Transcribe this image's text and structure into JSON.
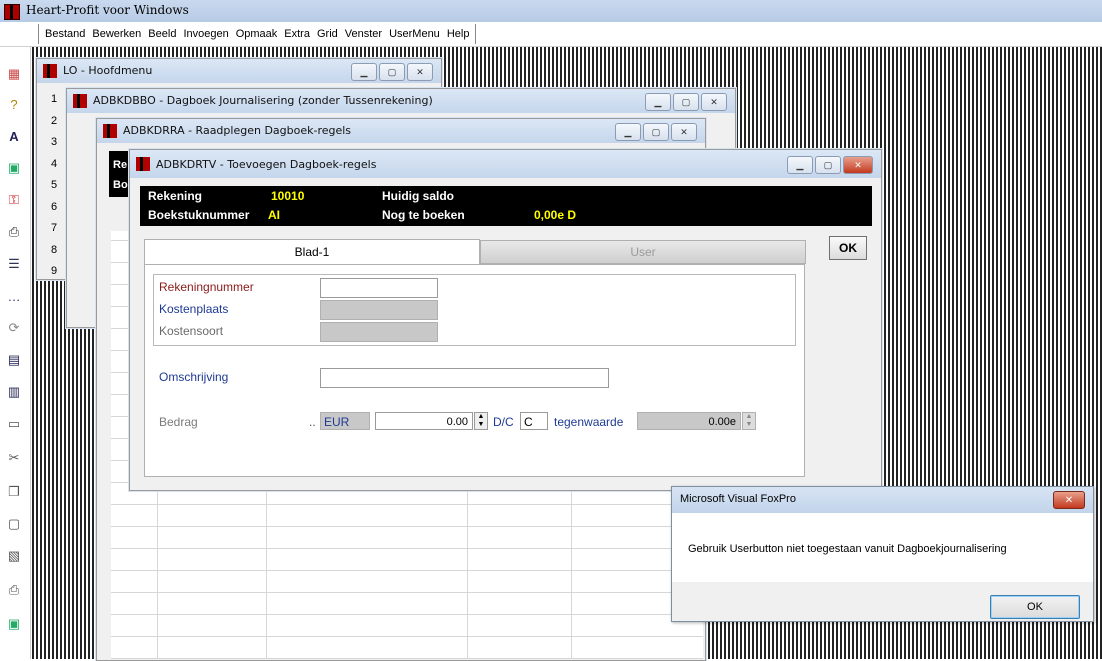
{
  "app": {
    "title": "Heart-Profit voor Windows"
  },
  "menu": [
    "Bestand",
    "Bewerken",
    "Beeld",
    "Invoegen",
    "Opmaak",
    "Extra",
    "Grid",
    "Venster",
    "UserMenu",
    "Help"
  ],
  "toolbar_icons": [
    "form-icon",
    "help-icon",
    "spell-icon",
    "calc-icon",
    "key-icon",
    "print-icon",
    "list-icon",
    "dots-icon",
    "refresh-icon",
    "edit-icon",
    "chart-icon",
    "window-icon",
    "cut-icon",
    "copy-icon",
    "paste-icon",
    "document-icon",
    "printer-icon",
    "screen-icon"
  ],
  "windows": {
    "w1": {
      "title": "LO - Hoofdmenu",
      "numbers": [
        "1",
        "2",
        "3",
        "4",
        "5",
        "6",
        "7",
        "8",
        "9"
      ]
    },
    "w2": {
      "title": "ADBKDBBO - Dagboek Journalisering (zonder Tussenrekening)"
    },
    "w3": {
      "title": "ADBKDRRA - Raadplegen Dagboek-regels",
      "partial": [
        "Re",
        "Bo"
      ]
    },
    "main": {
      "title": "ADBKDRTV - Toevoegen Dagboek-regels",
      "header": {
        "rekening_label": "Rekening",
        "rekening_value": "10010",
        "huidig_saldo_label": "Huidig saldo",
        "boekstuk_label": "Boekstuknummer",
        "boekstuk_value": "AI",
        "nog_label": "Nog te boeken",
        "nog_value": "0,00e D"
      },
      "tabs": [
        "Blad-1",
        "User"
      ],
      "ok_label": "OK",
      "fields": {
        "rekeningnummer": "Rekeningnummer",
        "kostenplaats": "Kostenplaats",
        "kostensoort": "Kostensoort",
        "omschrijving": "Omschrijving",
        "bedrag": "Bedrag",
        "bedrag_dots": "..",
        "currency": "EUR",
        "amount": "0.00",
        "dc_label": "D/C",
        "dc_value": "C",
        "tegenwaarde_label": "tegenwaarde",
        "tegenwaarde_value": "0.00e"
      }
    }
  },
  "dialog": {
    "title": "Microsoft Visual FoxPro",
    "message": "Gebruik Userbutton niet toegestaan vanuit Dagboekjournalisering",
    "ok_label": "OK"
  },
  "colors": {
    "dark_red_label": "#8b1a1a",
    "blue_label": "#1f3a93",
    "yellow_value": "#ffff00"
  }
}
